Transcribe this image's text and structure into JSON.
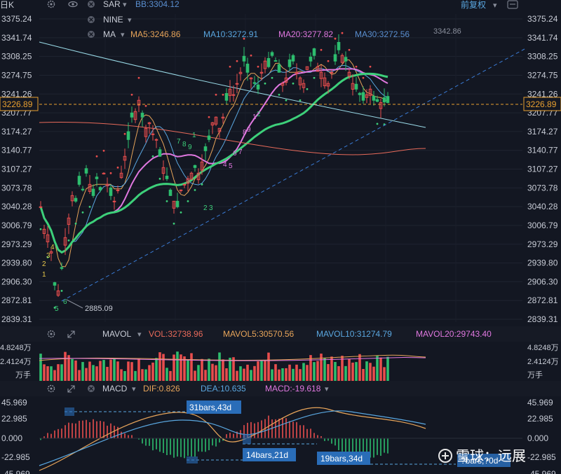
{
  "header": {
    "period": "日K",
    "adjust": "前复权",
    "rows": [
      {
        "name": "SAR",
        "values": [
          {
            "label": "BB:3304.12",
            "color": "#5a8fd0"
          }
        ]
      },
      {
        "name": "NINE",
        "values": []
      },
      {
        "name": "MA",
        "values": [
          {
            "label": "MA5:3246.86",
            "color": "#e8a55a"
          },
          {
            "label": "MA10:3272.91",
            "color": "#5aa7e0"
          },
          {
            "label": "MA20:3277.82",
            "color": "#e078e0"
          },
          {
            "label": "MA30:3272.56",
            "color": "#5a8fd0"
          }
        ]
      }
    ]
  },
  "price_axis": {
    "ticks": [
      "3375.24",
      "3341.74",
      "3308.25",
      "3274.75",
      "3241.26",
      "3207.77",
      "3174.27",
      "3140.77",
      "3107.27",
      "3073.78",
      "3040.28",
      "3006.79",
      "2973.29",
      "2939.80",
      "2906.30",
      "2872.81",
      "2839.31"
    ],
    "current": "3226.89",
    "high_label": "3342.86",
    "low_label": "2885.09"
  },
  "nine_labels": [
    "1",
    "2",
    "3",
    "4",
    "5",
    "6",
    "7",
    "8",
    "9"
  ],
  "vol_panel": {
    "name": "MAVOL",
    "stats": [
      {
        "label": "VOL:32738.96",
        "color": "#e86a5a"
      },
      {
        "label": "MAVOL5:30570.56",
        "color": "#e8a55a"
      },
      {
        "label": "MAVOL10:31274.79",
        "color": "#5aa7e0"
      },
      {
        "label": "MAVOL20:29743.40",
        "color": "#e078e0"
      }
    ],
    "ticks": [
      "4.8248万",
      "2.4124万",
      "万手"
    ]
  },
  "macd_panel": {
    "name": "MACD",
    "stats": [
      {
        "label": "DIF:0.826",
        "color": "#e8a55a"
      },
      {
        "label": "DEA:10.635",
        "color": "#5aa7e0"
      },
      {
        "label": "MACD:-19.618",
        "color": "#e078e0"
      }
    ],
    "ticks": [
      "45.969",
      "22.985",
      "0.000",
      "-22.985",
      "-45.969"
    ],
    "boxes": [
      "31bars,43d",
      "14bars,21d",
      "19bars,34d",
      "?bars,?0d"
    ]
  },
  "watermark": "雪球：远展",
  "chart_data": {
    "type": "candlestick",
    "ylim": [
      2839.31,
      3375.24
    ],
    "price_range_shown": {
      "low": 2885.09,
      "high": 3342.86,
      "last": 3226.89
    },
    "macd_ylim": [
      -45.969,
      45.969
    ]
  }
}
